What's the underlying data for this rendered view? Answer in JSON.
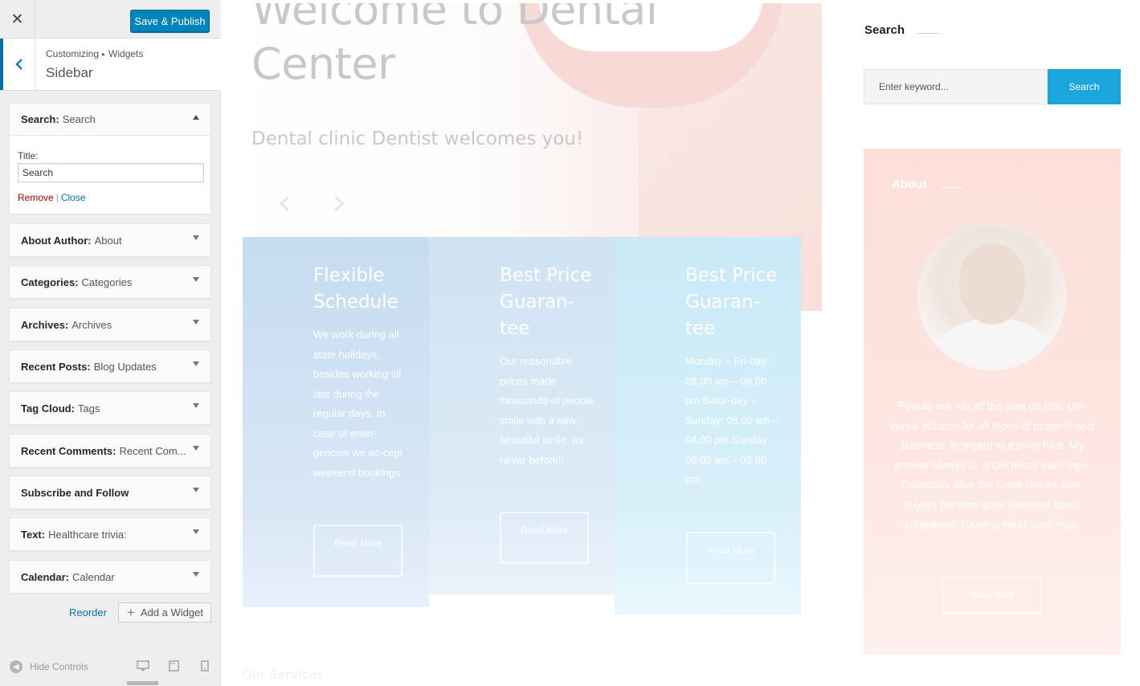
{
  "customizer": {
    "close_symbol": "✕",
    "save_label": "Save & Publish",
    "breadcrumb": [
      "Customizing",
      "▸",
      "Widgets"
    ],
    "section_title": "Sidebar",
    "search_widget": {
      "type_label": "Search:",
      "name": "Search",
      "title_label": "Title:",
      "title_value": "Search",
      "remove_label": "Remove",
      "separator": "|",
      "close_label": "Close"
    },
    "widgets": [
      {
        "type": "About Author:",
        "name": "About"
      },
      {
        "type": "Categories:",
        "name": "Categories"
      },
      {
        "type": "Archives:",
        "name": "Archives"
      },
      {
        "type": "Recent Posts:",
        "name": "Blog Updates"
      },
      {
        "type": "Tag Cloud:",
        "name": "Tags"
      },
      {
        "type": "Recent Comments:",
        "name": "Recent Com..."
      },
      {
        "type": "Subscribe and Follow",
        "name": ""
      },
      {
        "type": "Text:",
        "name": "Healthcare trivia:"
      },
      {
        "type": "Calendar:",
        "name": "Calendar"
      }
    ],
    "reorder_label": "Reorder",
    "add_widget_label": "Add a Widget",
    "add_widget_symbol": "+",
    "hide_controls_label": "Hide Controls"
  },
  "preview": {
    "hero_title": "Welcome to Dental Center",
    "hero_subtitle": "Dental clinic Dentist welcomes you!",
    "cards": [
      {
        "title": "Flexible Schedule",
        "text": "We work during all state holidays, besides working till late during the regular days. In case of emer-gencies we ac-cept weekend bookings.",
        "button": "Read More"
      },
      {
        "title": "Best Price Guaran-tee",
        "text": "Our reasonable prices made thousands of people smile with a new, beautiful smile, as never before!!",
        "button": "Read More"
      },
      {
        "title": "Best Price Guaran-tee",
        "text": "Monday – Fri-day:  08.00 am – 06.00 pm Satur-day – Sunday: 08.00 am – 04.00 pm Sunday: 08.00 am – 02.00 pm",
        "button": "Read More"
      }
    ],
    "services_heading": "Our Services",
    "sidebar": {
      "search_title": "Search",
      "search_placeholder": "Enter keyword...",
      "search_button": "Search",
      "about_title": "About",
      "about_text": "People ask me all the time on one, uni-versal solution for all types of property and business, in regard to a price hike. My answer always is: show better earn-ings. Especially after the Great Reces-sion, buyers became quite skeptical about companies showing weak earn-ings.",
      "about_button": "Read More"
    }
  },
  "colors": {
    "admin_blue": "#0085ba",
    "link_blue": "#0073aa",
    "remove_red": "#a00",
    "search_button": "#1aa6dc",
    "about_bg": "#fcdfd8"
  }
}
